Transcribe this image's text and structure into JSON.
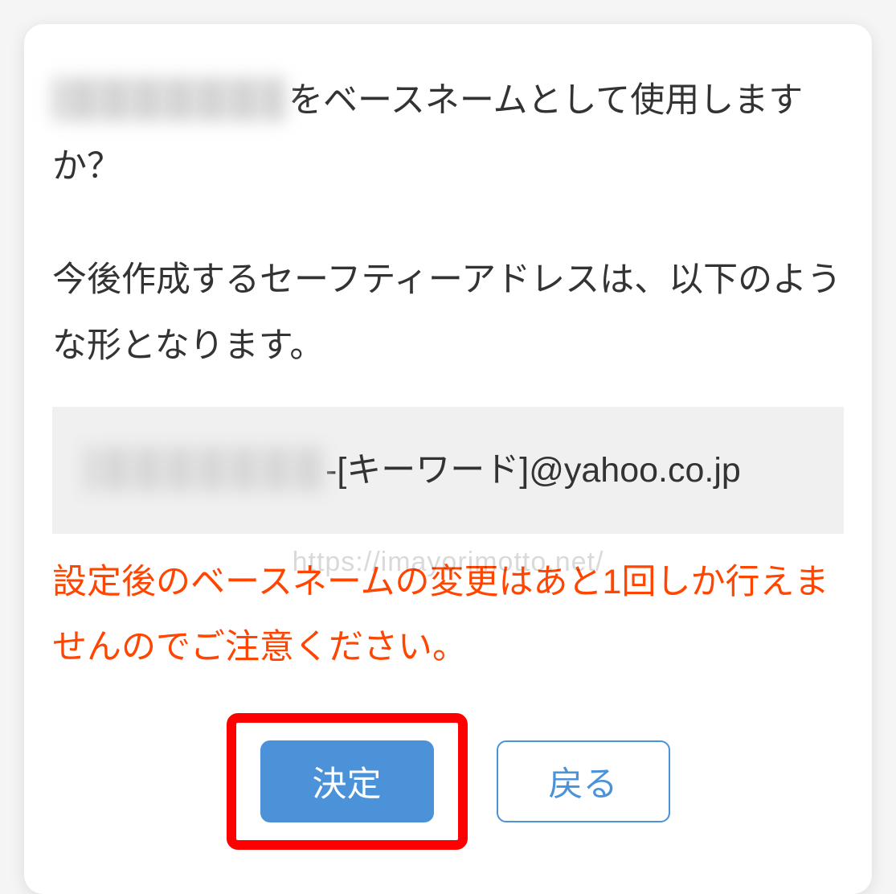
{
  "dialog": {
    "question_suffix": "をベースネームとして使用しますか？",
    "description": "今後作成するセーフティーアドレスは、以下のような形となります。",
    "address_suffix": "-[キーワード]@yahoo.co.jp",
    "warning": "設定後のベースネームの変更はあと1回しか行えませんのでご注意ください。",
    "buttons": {
      "confirm": "決定",
      "back": "戻る"
    }
  },
  "watermark": "https://imayorimotto.net/",
  "colors": {
    "warning": "#ff4500",
    "primary": "#4b92d9",
    "highlight_border": "#ff0000"
  }
}
